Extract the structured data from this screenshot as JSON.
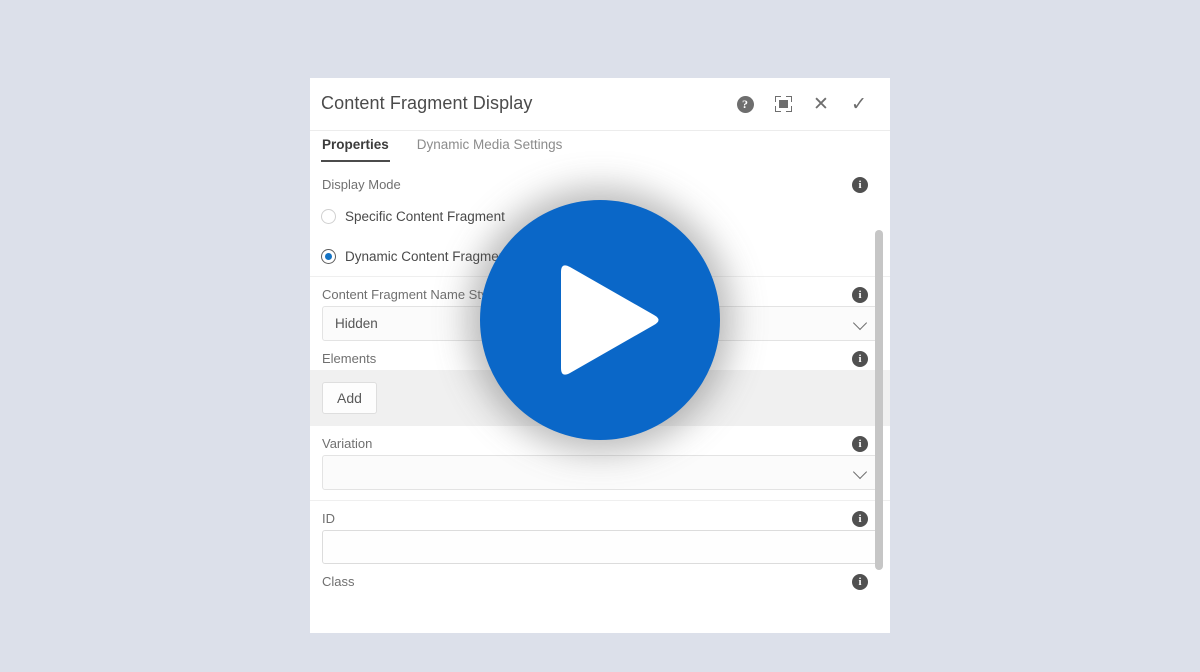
{
  "dialog": {
    "title": "Content Fragment Display",
    "actions": [
      {
        "name": "help-icon",
        "label": "?"
      },
      {
        "name": "fullscreen-icon",
        "label": ""
      },
      {
        "name": "close-icon",
        "label": "✕"
      },
      {
        "name": "confirm-icon",
        "label": "✓"
      }
    ]
  },
  "tabs": [
    {
      "label": "Properties",
      "active": true
    },
    {
      "label": "Dynamic Media Settings",
      "active": false
    }
  ],
  "fields": {
    "display_mode": {
      "label": "Display Mode",
      "options": [
        {
          "label": "Specific Content Fragment",
          "selected": false
        },
        {
          "label": "Dynamic Content Fragment",
          "selected": true
        }
      ]
    },
    "name_styling": {
      "label": "Content Fragment Name Styling",
      "value": "Hidden"
    },
    "elements": {
      "label": "Elements",
      "add_label": "Add"
    },
    "variation": {
      "label": "Variation",
      "value": ""
    },
    "id": {
      "label": "ID",
      "value": ""
    },
    "class": {
      "label": "Class"
    }
  },
  "overlay": {
    "play_button": "play-button"
  },
  "colors": {
    "accent_blue": "#0a67c8",
    "page_background": "#dce0ea",
    "panel_gray": "#f0f0f0",
    "info_icon": "#505050"
  }
}
